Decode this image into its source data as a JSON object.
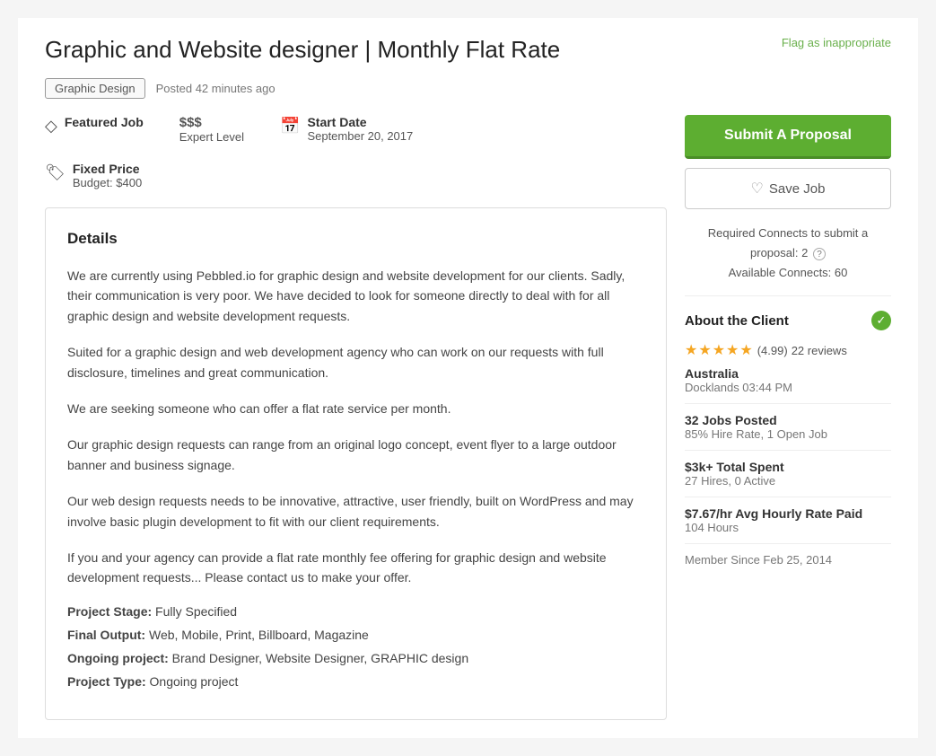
{
  "page": {
    "flag_label": "Flag as inappropriate",
    "job_title": "Graphic and Website designer | Monthly Flat Rate"
  },
  "meta": {
    "tag": "Graphic Design",
    "posted": "Posted 42 minutes ago"
  },
  "job_info": {
    "featured_label": "Featured Job",
    "price_level": "$$$",
    "price_sub": "Expert Level",
    "fixed_price_label": "Fixed Price",
    "budget": "Budget: $400",
    "start_date_label": "Start Date",
    "start_date": "September 20, 2017"
  },
  "details": {
    "title": "Details",
    "paragraphs": [
      "We are currently using Pebbled.io for graphic design and website development for our clients.  Sadly, their communication is very poor.  We have decided to look for someone directly to deal with for all graphic design and website development requests.",
      "Suited for a graphic design and web development agency who can work on our requests with full disclosure, timelines and great communication.",
      "We are seeking someone who can offer a flat rate service per month.",
      "Our graphic design requests can range from an original logo concept, event flyer to a large outdoor banner and business signage.",
      "Our web design requests needs to be innovative, attractive, user friendly, built on WordPress and may involve basic plugin development to fit with our client requirements.",
      "If you and your agency can provide a flat rate monthly fee offering for graphic design and website development requests... Please contact us to make your offer."
    ],
    "project_meta": [
      {
        "label": "Project Stage:",
        "value": "  Fully Specified"
      },
      {
        "label": "Final Output:",
        "value": "  Web, Mobile, Print, Billboard, Magazine"
      },
      {
        "label": "Ongoing project:",
        "value": "   Brand Designer, Website Designer, GRAPHIC design"
      },
      {
        "label": "Project Type:",
        "value": "  Ongoing project"
      }
    ]
  },
  "sidebar": {
    "submit_label": "Submit A Proposal",
    "save_label": "Save Job",
    "connects_line1": "Required Connects to submit a",
    "connects_line2": "proposal: 2",
    "connects_line3": "Available Connects: 60",
    "about_title": "About the Client",
    "rating": "4.99",
    "reviews": "22 reviews",
    "country": "Australia",
    "city": "Docklands 03:44 PM",
    "jobs_posted_label": "32 Jobs Posted",
    "jobs_posted_sub": "85% Hire Rate, 1 Open Job",
    "total_spent_label": "$3k+ Total Spent",
    "total_spent_sub": "27 Hires, 0 Active",
    "avg_rate_label": "$7.67/hr Avg Hourly Rate Paid",
    "avg_rate_sub": "104 Hours",
    "member_since": "Member Since Feb 25, 2014"
  }
}
